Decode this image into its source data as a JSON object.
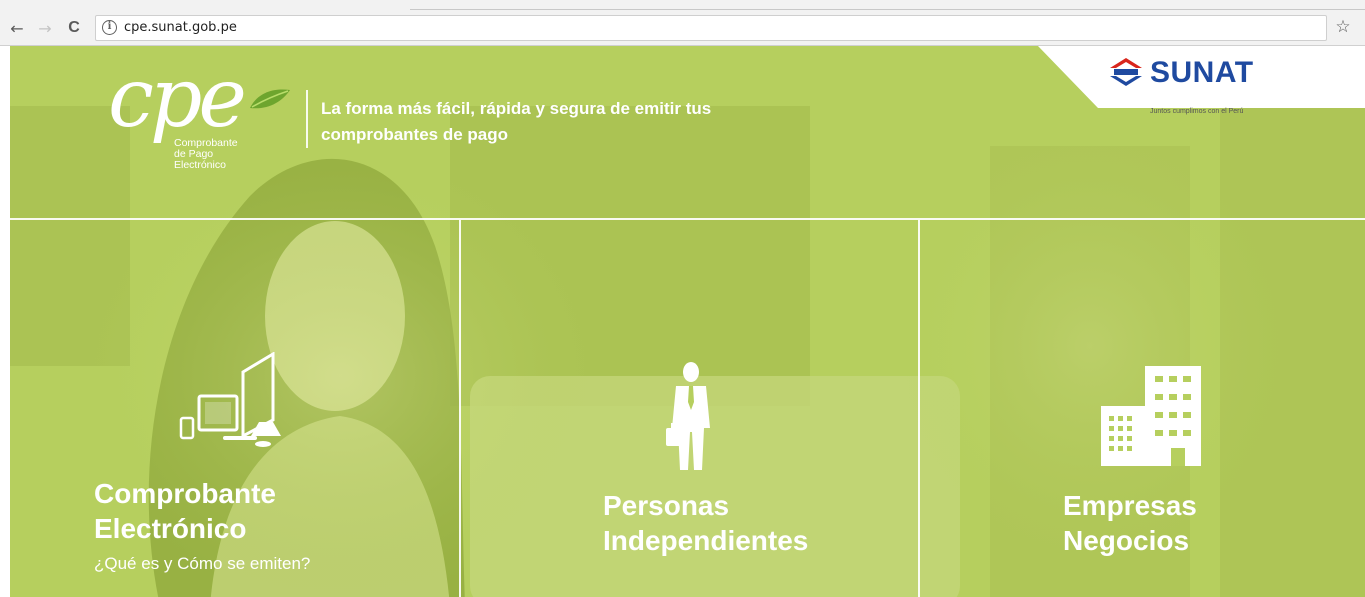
{
  "browser": {
    "url": "cpe.sunat.gob.pe",
    "back_icon": "←",
    "forward_icon": "→",
    "reload_icon": "C",
    "info_icon": "i",
    "star_icon": "☆"
  },
  "header": {
    "logo_text": "cpe",
    "logo_subtitle_1": "Comprobante",
    "logo_subtitle_2": "de Pago",
    "logo_subtitle_3": "Electrónico",
    "tagline_1": "La forma más fácil, rápida y segura de emitir tus",
    "tagline_2": "comprobantes de pago"
  },
  "sunat": {
    "name": "SUNAT",
    "slogan": "Juntos cumplimos con el Perú",
    "brand_blue": "#1f4aa0",
    "brand_red": "#d9261c"
  },
  "cards": [
    {
      "title_1": "Comprobante",
      "title_2": "Electrónico",
      "subtitle": "¿Qué es y Cómo se emiten?",
      "icon": "devices-icon"
    },
    {
      "title_1": "Personas",
      "title_2": "Independientes",
      "icon": "businessman-icon"
    },
    {
      "title_1": "Empresas",
      "title_2": "Negocios",
      "icon": "building-icon"
    }
  ],
  "colors": {
    "overlay_green": "#b6cf5e",
    "white": "#ffffff"
  }
}
